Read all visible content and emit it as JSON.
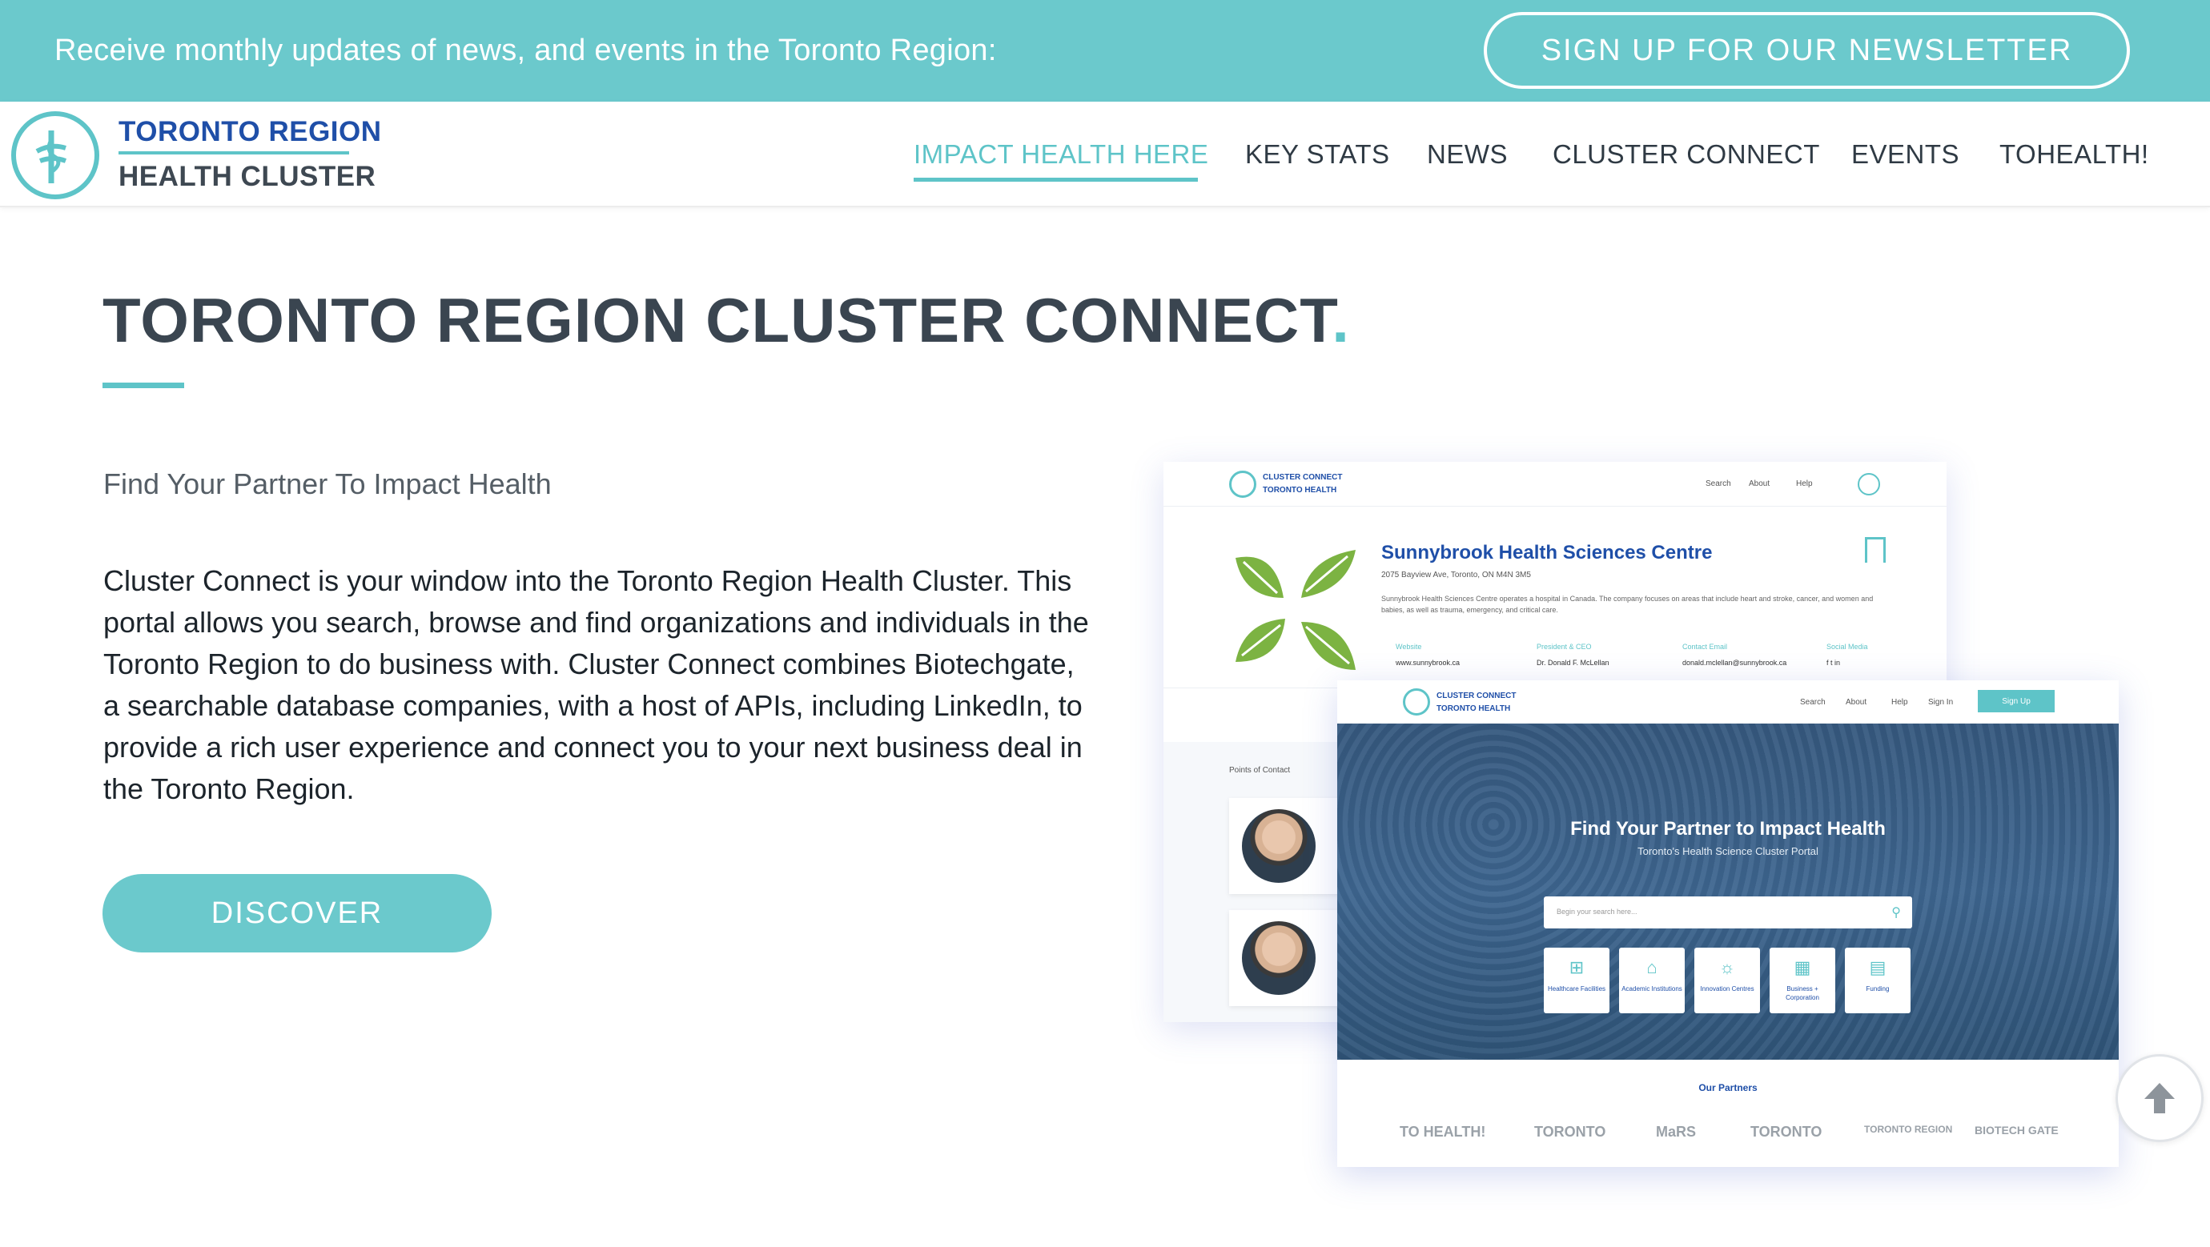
{
  "topbar": {
    "text": "Receive monthly updates of news, and events in the Toronto Region:",
    "newsletter_button": "SIGN UP FOR OUR NEWSLETTER"
  },
  "header": {
    "logo_line1": "TORONTO REGION",
    "logo_line2": "HEALTH CLUSTER",
    "nav": [
      {
        "label": "IMPACT HEALTH HERE",
        "active": true
      },
      {
        "label": "KEY STATS",
        "active": false
      },
      {
        "label": "NEWS",
        "active": false
      },
      {
        "label": "CLUSTER CONNECT",
        "active": false
      },
      {
        "label": "EVENTS",
        "active": false
      },
      {
        "label": "TOHEALTH!",
        "active": false
      }
    ]
  },
  "main": {
    "title": "TORONTO REGION CLUSTER CONNECT",
    "title_dot": ".",
    "subtitle": "Find Your Partner To Impact Health",
    "body": "Cluster Connect is your window into the Toronto Region Health Cluster. This portal allows you search, browse and find organizations and individuals in the Toronto Region to do business with.  Cluster Connect combines Biotechgate, a searchable database companies, with a host of APIs, including LinkedIn, to provide a rich user experience and connect you to your next business deal in the Toronto Region.",
    "discover_button": "DISCOVER"
  },
  "mockup_back": {
    "logo_line1": "CLUSTER CONNECT",
    "logo_line2": "TORONTO HEALTH",
    "nav": [
      "Search",
      "About",
      "Help"
    ],
    "org_name": "Sunnybrook Health Sciences Centre",
    "address": "2075 Bayview Ave, Toronto, ON M4N 3M5",
    "description": "Sunnybrook Health Sciences Centre operates a hospital in Canada. The company focuses on areas that include heart and stroke, cancer, and women and babies, as well as trauma, emergency, and critical care.",
    "fields": [
      {
        "label": "Website",
        "value": "www.sunnybrook.ca"
      },
      {
        "label": "President & CEO",
        "value": "Dr. Donald F. McLellan"
      },
      {
        "label": "Contact Email",
        "value": "donald.mclellan@sunnybrook.ca"
      },
      {
        "label": "Social Media",
        "value": "f  t  in"
      }
    ],
    "points_of_contact": "Points of Contact"
  },
  "mockup_front": {
    "logo_line1": "CLUSTER CONNECT",
    "logo_line2": "TORONTO HEALTH",
    "nav": [
      "Search",
      "About",
      "Help",
      "Sign In"
    ],
    "signup": "Sign Up",
    "hero_title": "Find Your Partner to Impact Health",
    "hero_subtitle": "Toronto's Health Science Cluster Portal",
    "search_placeholder": "Begin your search here...",
    "tiles": [
      {
        "label": "Healthcare Facilities",
        "icon": "hospital-icon"
      },
      {
        "label": "Academic Institutions",
        "icon": "school-icon"
      },
      {
        "label": "Innovation Centres",
        "icon": "lightbulb-icon"
      },
      {
        "label": "Business + Corporation",
        "icon": "building-icon"
      },
      {
        "label": "Funding",
        "icon": "chart-icon"
      }
    ],
    "partners_title": "Our Partners",
    "partners": [
      "TO HEALTH!",
      "TORONTO",
      "MaRS",
      "TORONTO",
      "TORONTO REGION",
      "BIOTECH GATE"
    ]
  },
  "colors": {
    "accent": "#6bc9cc",
    "brand_blue": "#1f4fa8",
    "text_dark": "#3a4550"
  }
}
